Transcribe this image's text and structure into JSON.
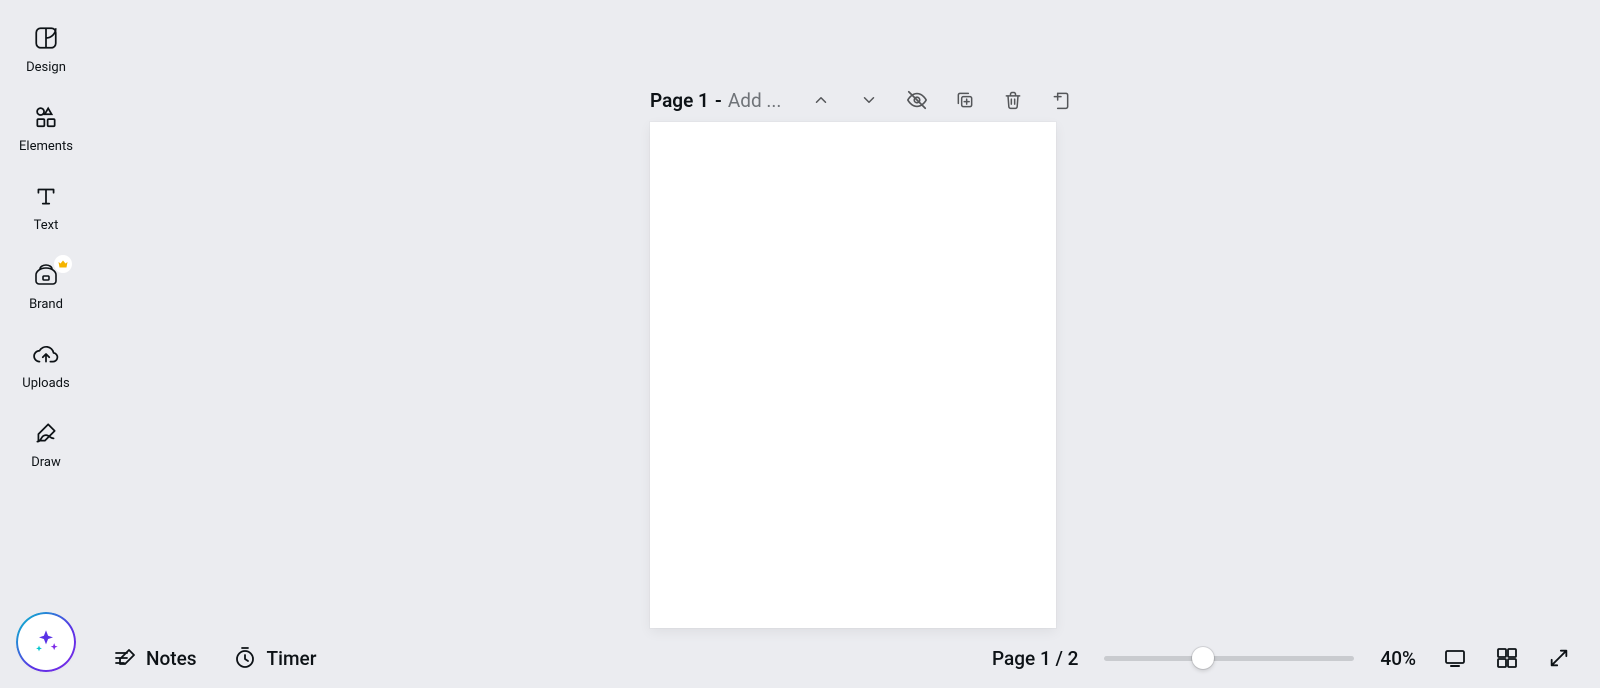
{
  "sidebar": {
    "items": [
      {
        "label": "Design"
      },
      {
        "label": "Elements"
      },
      {
        "label": "Text"
      },
      {
        "label": "Brand"
      },
      {
        "label": "Uploads"
      },
      {
        "label": "Draw"
      }
    ]
  },
  "page_header": {
    "title": "Page 1",
    "separator": "-",
    "add_placeholder": "Add ..."
  },
  "bottom_bar": {
    "notes_label": "Notes",
    "timer_label": "Timer",
    "page_indicator": "Page 1 / 2",
    "zoom_percent": "40%",
    "zoom_value": 40,
    "zoom_min": 0,
    "zoom_max": 100
  }
}
